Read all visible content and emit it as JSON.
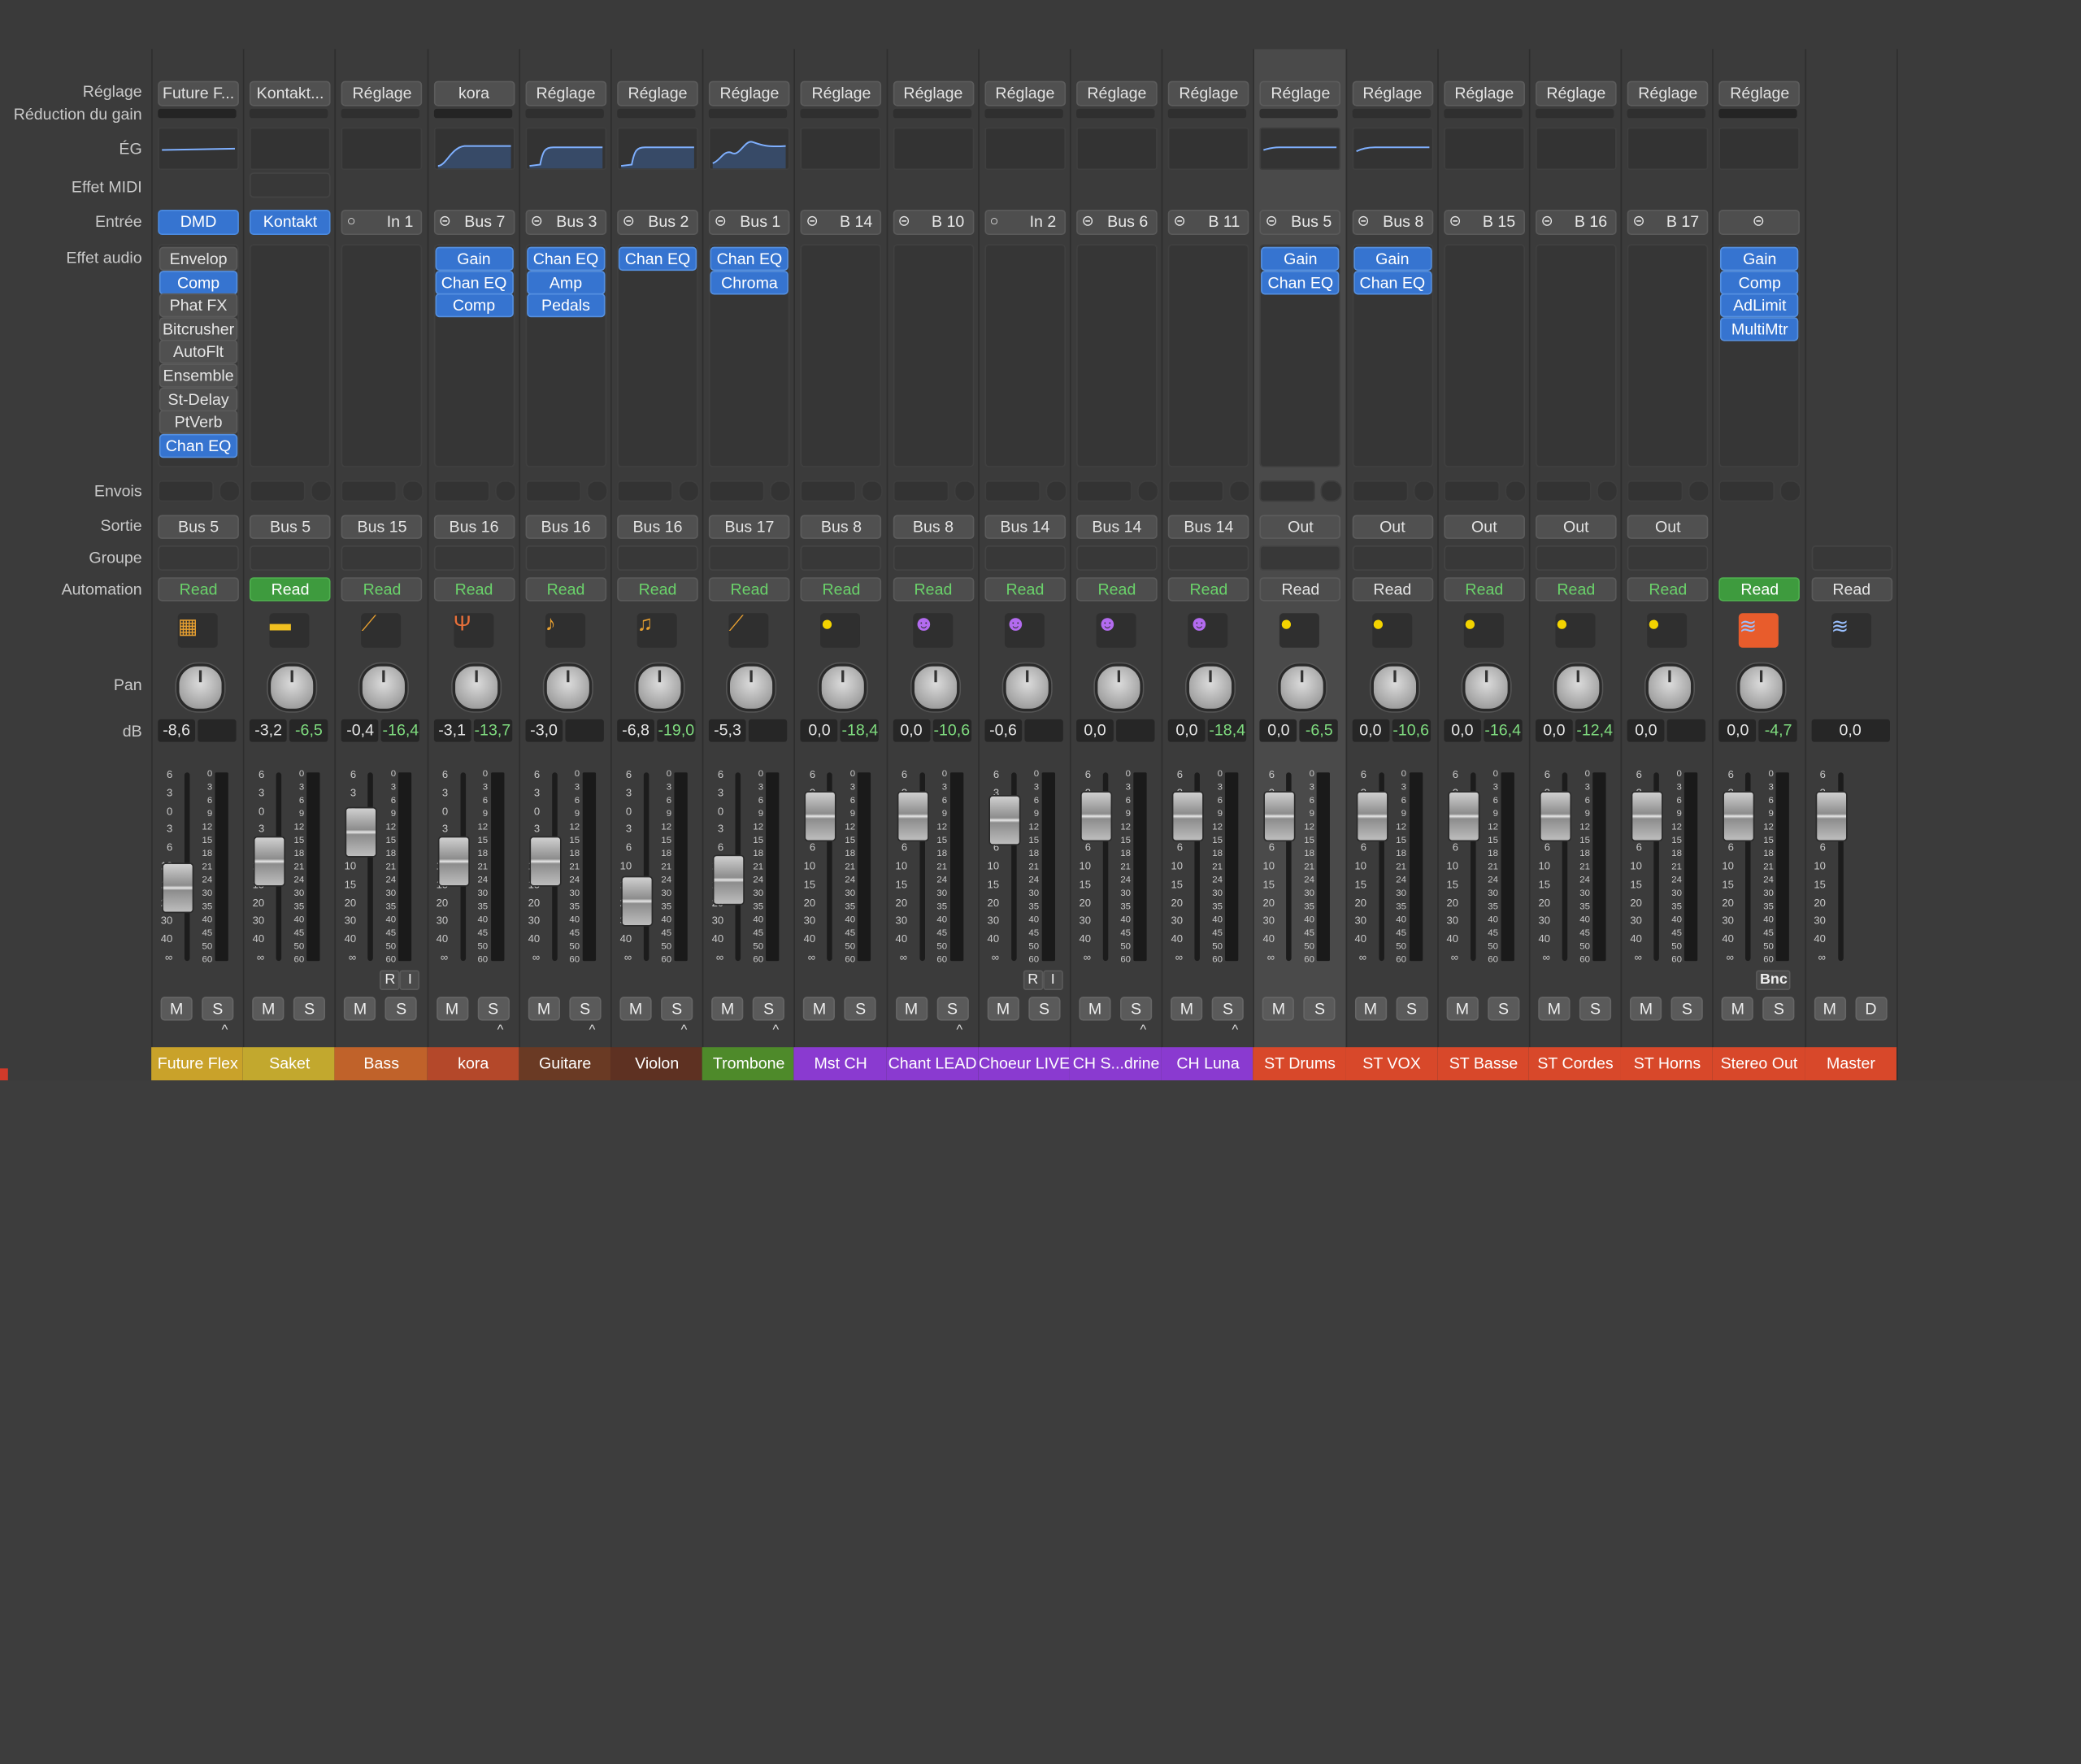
{
  "row_labels": {
    "setting": "Réglage",
    "gain_reduction": "Réduction du gain",
    "eq": "ÉG",
    "midi_fx": "Effet MIDI",
    "input": "Entrée",
    "audio_fx": "Effet audio",
    "sends": "Envois",
    "output": "Sortie",
    "group": "Groupe",
    "automation": "Automation",
    "pan": "Pan",
    "db": "dB"
  },
  "fader_scale": [
    "6",
    "3",
    "0",
    "3",
    "6",
    "10",
    "15",
    "20",
    "30",
    "40",
    "∞"
  ],
  "meter_scale": [
    "0",
    "3",
    "6",
    "9",
    "12",
    "15",
    "18",
    "21",
    "24",
    "30",
    "35",
    "40",
    "45",
    "50",
    "60"
  ],
  "mute_label": "M",
  "solo_label": "S",
  "dim_label": "D",
  "r_label": "R",
  "i_label": "I",
  "bnc_label": "Bnc",
  "strips": [
    {
      "name": "Future Flex",
      "color": "#c9a22a",
      "setting": "Future F...",
      "input": "DMD",
      "input_blue": true,
      "input_icon": "",
      "fx": [
        {
          "t": "Envelop",
          "b": false
        },
        {
          "t": "Comp",
          "b": true
        },
        {
          "t": "Phat FX",
          "b": false
        },
        {
          "t": "Bitcrusher",
          "b": false
        },
        {
          "t": "AutoFlt",
          "b": false
        },
        {
          "t": "Ensemble",
          "b": false
        },
        {
          "t": "St-Delay",
          "b": false
        },
        {
          "t": "PtVerb",
          "b": false
        },
        {
          "t": "Chan EQ",
          "b": true
        }
      ],
      "output": "Bus 5",
      "automation": "Read",
      "auto_style": "greentext",
      "icon": "drum-machine-icon",
      "glyph": "▦",
      "db_l": "-8,6",
      "db_r": "",
      "fader_level": 0.48,
      "gr": "dark",
      "eq": "flat",
      "caret": true
    },
    {
      "name": "Saket",
      "color": "#c2a82e",
      "setting": "Kontakt...",
      "input": "Kontakt",
      "input_blue": true,
      "input_icon": "",
      "fx": [],
      "output": "Bus 5",
      "automation": "Read",
      "auto_style": "green",
      "icon": "bongo-icon",
      "glyph": "▬",
      "db_l": "-3,2",
      "db_r": "-6,5",
      "fader_level": 0.34,
      "gr": "none",
      "eq": "none",
      "caret": false,
      "midi": true
    },
    {
      "name": "Bass",
      "color": "#c0622a",
      "setting": "Réglage",
      "input": "In 1",
      "input_blue": false,
      "input_icon": "○",
      "fx": [],
      "output": "Bus 15",
      "automation": "Read",
      "auto_style": "greentext",
      "icon": "bass-guitar-icon",
      "glyph": "⟋",
      "db_l": "-0,4",
      "db_r": "-16,4",
      "fader_level": 0.18,
      "gr": "none",
      "eq": "none",
      "caret": false,
      "ri": true
    },
    {
      "name": "kora",
      "color": "#b4482a",
      "setting": "kora",
      "input": "Bus 7",
      "input_blue": false,
      "input_icon": "⊝",
      "fx": [
        {
          "t": "Gain",
          "b": true
        },
        {
          "t": "Chan EQ",
          "b": true
        },
        {
          "t": "Comp",
          "b": true
        }
      ],
      "output": "Bus 16",
      "automation": "Read",
      "auto_style": "greentext",
      "icon": "harp-icon",
      "glyph": "Ψ",
      "db_l": "-3,1",
      "db_r": "-13,7",
      "fader_level": 0.34,
      "gr": "dark",
      "eq": "curve1",
      "caret": true
    },
    {
      "name": "Guitare",
      "color": "#6a3a24",
      "setting": "Réglage",
      "input": "Bus 3",
      "input_blue": false,
      "input_icon": "⊝",
      "fx": [
        {
          "t": "Chan EQ",
          "b": true
        },
        {
          "t": "Amp",
          "b": true
        },
        {
          "t": "Pedals",
          "b": true
        }
      ],
      "output": "Bus 16",
      "automation": "Read",
      "auto_style": "greentext",
      "icon": "acoustic-guitar-icon",
      "glyph": "♪",
      "db_l": "-3,0",
      "db_r": "",
      "fader_level": 0.34,
      "gr": "none",
      "eq": "curve2",
      "caret": true
    },
    {
      "name": "Violon",
      "color": "#5e3122",
      "setting": "Réglage",
      "input": "Bus 2",
      "input_blue": false,
      "input_icon": "⊝",
      "fx": [
        {
          "t": "Chan EQ",
          "b": true
        }
      ],
      "output": "Bus 16",
      "automation": "Read",
      "auto_style": "greentext",
      "icon": "violin-icon",
      "glyph": "♫",
      "db_l": "-6,8",
      "db_r": "-19,0",
      "fader_level": 0.55,
      "gr": "none",
      "eq": "curve2",
      "caret": true
    },
    {
      "name": "Trombone",
      "color": "#4e8a2a",
      "setting": "Réglage",
      "input": "Bus 1",
      "input_blue": false,
      "input_icon": "⊝",
      "fx": [
        {
          "t": "Chan EQ",
          "b": true
        },
        {
          "t": "Chroma",
          "b": true
        }
      ],
      "output": "Bus 17",
      "automation": "Read",
      "auto_style": "greentext",
      "icon": "trombone-icon",
      "glyph": "⟋",
      "db_l": "-5,3",
      "db_r": "",
      "fader_level": 0.44,
      "gr": "none",
      "eq": "curve3",
      "caret": true
    },
    {
      "name": "Mst CH",
      "color": "#8a3ad0",
      "setting": "Réglage",
      "input": "B 14",
      "input_blue": false,
      "input_icon": "⊝",
      "fx": [],
      "output": "Bus 8",
      "automation": "Read",
      "auto_style": "greentext",
      "icon": "speaker-knob-icon",
      "glyph": "●",
      "db_l": "0,0",
      "db_r": "-18,4",
      "fader_level": 0.1,
      "gr": "none",
      "eq": "none",
      "caret": false
    },
    {
      "name": "Chant LEAD",
      "color": "#8a3ad0",
      "setting": "Réglage",
      "input": "B 10",
      "input_blue": false,
      "input_icon": "⊝",
      "fx": [],
      "output": "Bus 8",
      "automation": "Read",
      "auto_style": "greentext",
      "icon": "singer-icon",
      "glyph": "☻",
      "db_l": "0,0",
      "db_r": "-10,6",
      "fader_level": 0.1,
      "gr": "none",
      "eq": "none",
      "caret": true
    },
    {
      "name": "Choeur LIVE",
      "color": "#8a3ad0",
      "setting": "Réglage",
      "input": "In 2",
      "input_blue": false,
      "input_icon": "○",
      "fx": [],
      "output": "Bus 14",
      "automation": "Read",
      "auto_style": "greentext",
      "icon": "choir-icon",
      "glyph": "☻",
      "db_l": "-0,6",
      "db_r": "",
      "fader_level": 0.12,
      "gr": "none",
      "eq": "none",
      "caret": false,
      "ri": true
    },
    {
      "name": "CH S...drine",
      "color": "#8a3ad0",
      "setting": "Réglage",
      "input": "Bus 6",
      "input_blue": false,
      "input_icon": "⊝",
      "fx": [],
      "output": "Bus 14",
      "automation": "Read",
      "auto_style": "greentext",
      "icon": "choir-icon",
      "glyph": "☻",
      "db_l": "0,0",
      "db_r": "",
      "fader_level": 0.1,
      "gr": "none",
      "eq": "none",
      "caret": true
    },
    {
      "name": "CH Luna",
      "color": "#8a3ad0",
      "setting": "Réglage",
      "input": "B 11",
      "input_blue": false,
      "input_icon": "⊝",
      "fx": [],
      "output": "Bus 14",
      "automation": "Read",
      "auto_style": "greentext",
      "icon": "choir-icon",
      "glyph": "☻",
      "db_l": "0,0",
      "db_r": "-18,4",
      "fader_level": 0.1,
      "gr": "none",
      "eq": "none",
      "caret": true
    },
    {
      "name": "ST Drums",
      "color": "#d8482a",
      "setting": "Réglage",
      "input": "Bus 5",
      "input_blue": false,
      "input_icon": "⊝",
      "fx": [
        {
          "t": "Gain",
          "b": true
        },
        {
          "t": "Chan EQ",
          "b": true
        }
      ],
      "output": "Out",
      "automation": "Read",
      "auto_style": "white",
      "icon": "speaker-knob-icon",
      "glyph": "●",
      "db_l": "0,0",
      "db_r": "-6,5",
      "fader_level": 0.1,
      "gr": "none",
      "eq": "flatlow",
      "caret": false,
      "selected": true
    },
    {
      "name": "ST VOX",
      "color": "#d8482a",
      "setting": "Réglage",
      "input": "Bus 8",
      "input_blue": false,
      "input_icon": "⊝",
      "fx": [
        {
          "t": "Gain",
          "b": true
        },
        {
          "t": "Chan EQ",
          "b": true
        }
      ],
      "output": "Out",
      "automation": "Read",
      "auto_style": "white",
      "icon": "speaker-knob-icon",
      "glyph": "●",
      "db_l": "0,0",
      "db_r": "-10,6",
      "fader_level": 0.1,
      "gr": "none",
      "eq": "flatlow2",
      "caret": false
    },
    {
      "name": "ST Basse",
      "color": "#d8482a",
      "setting": "Réglage",
      "input": "B 15",
      "input_blue": false,
      "input_icon": "⊝",
      "fx": [],
      "output": "Out",
      "automation": "Read",
      "auto_style": "greentext",
      "icon": "speaker-knob-icon",
      "glyph": "●",
      "db_l": "0,0",
      "db_r": "-16,4",
      "fader_level": 0.1,
      "gr": "none",
      "eq": "none",
      "caret": false
    },
    {
      "name": "ST Cordes",
      "color": "#d8482a",
      "setting": "Réglage",
      "input": "B 16",
      "input_blue": false,
      "input_icon": "⊝",
      "fx": [],
      "output": "Out",
      "automation": "Read",
      "auto_style": "greentext",
      "icon": "speaker-knob-icon",
      "glyph": "●",
      "db_l": "0,0",
      "db_r": "-12,4",
      "fader_level": 0.1,
      "gr": "none",
      "eq": "none",
      "caret": false
    },
    {
      "name": "ST Horns",
      "color": "#d8482a",
      "setting": "Réglage",
      "input": "B 17",
      "input_blue": false,
      "input_icon": "⊝",
      "fx": [],
      "output": "Out",
      "automation": "Read",
      "auto_style": "greentext",
      "icon": "speaker-knob-icon",
      "glyph": "●",
      "db_l": "0,0",
      "db_r": "",
      "fader_level": 0.1,
      "gr": "none",
      "eq": "none",
      "caret": false
    },
    {
      "name": "Stereo Out",
      "color": "#d8482a",
      "setting": "Réglage",
      "input": "",
      "input_blue": false,
      "input_icon": "⊝",
      "fx": [
        {
          "t": "Gain",
          "b": true
        },
        {
          "t": "Comp",
          "b": true
        },
        {
          "t": "AdLimit",
          "b": true
        },
        {
          "t": "MultiMtr",
          "b": true
        }
      ],
      "output": "",
      "automation": "Read",
      "auto_style": "green",
      "icon": "waveform-icon",
      "glyph": "≋",
      "db_l": "0,0",
      "db_r": "-4,7",
      "fader_level": 0.1,
      "gr": "dark",
      "eq": "none",
      "caret": false,
      "bnc": true,
      "centerlink": true
    },
    {
      "name": "Master",
      "color": "#d8482a",
      "setting": "",
      "input": "",
      "input_blue": false,
      "input_icon": "",
      "fx": [],
      "output": "",
      "automation": "Read",
      "auto_style": "white",
      "icon": "waveform-icon",
      "glyph": "≋",
      "db_l": "0,0",
      "db_r": "",
      "fader_level": 0.1,
      "gr": "none",
      "eq": "none",
      "caret": false,
      "master": true
    }
  ]
}
